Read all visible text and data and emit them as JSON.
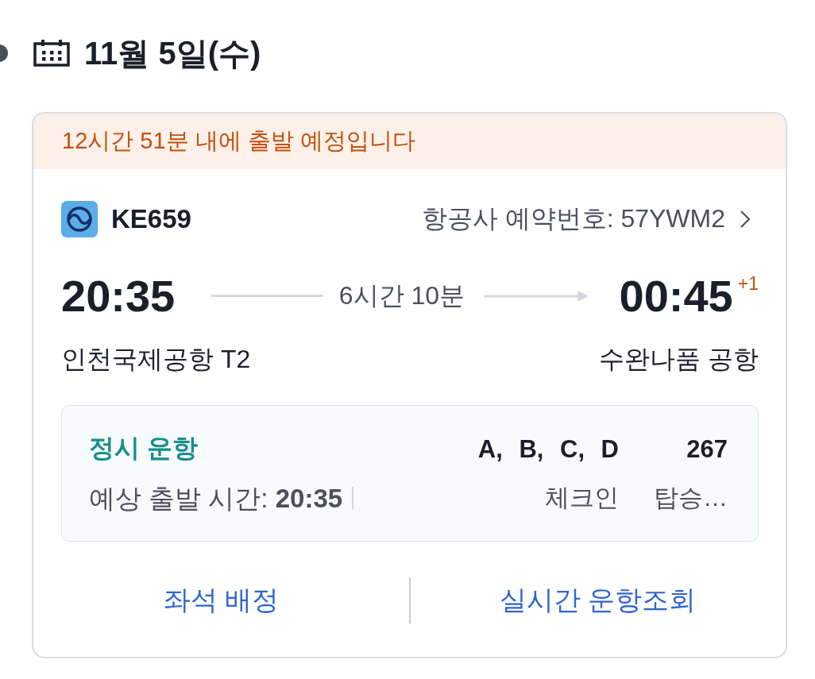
{
  "date_header": {
    "date": "11월 5일(수)"
  },
  "flight_card": {
    "banner": "12시간 51분 내에 출발 예정입니다",
    "flight_number": "KE659",
    "booking_reference": "항공사 예약번호: 57YWM2",
    "departure": {
      "time": "20:35",
      "airport": "인천국제공항 T2"
    },
    "duration": "6시간 10분",
    "arrival": {
      "time": "00:45",
      "day_offset": "+1",
      "airport": "수완나품 공항"
    },
    "status": {
      "label": "정시 운항",
      "estimate": "예상 출발 시간: **20:35**"
    },
    "info_columns": [
      {
        "value": "A, B, C, D",
        "label": "체크인"
      },
      {
        "value": "267",
        "label": "탑승…"
      }
    ],
    "actions": [
      {
        "label": "좌석 배정"
      },
      {
        "label": "실시간 운항조회"
      }
    ]
  }
}
